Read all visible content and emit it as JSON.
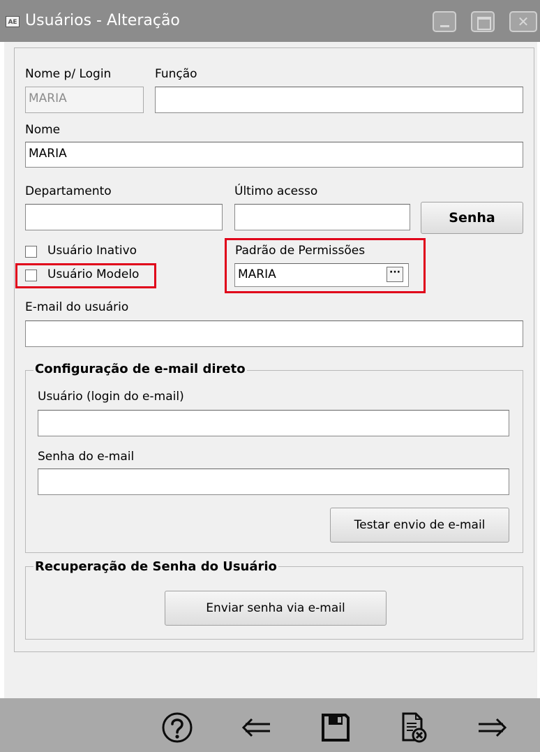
{
  "window": {
    "title": "Usuários - Alteração",
    "app_icon_text": "AE"
  },
  "form": {
    "login_label": "Nome p/ Login",
    "login_value": "MARIA",
    "funcao_label": "Função",
    "funcao_value": "",
    "nome_label": "Nome",
    "nome_value": "MARIA",
    "departamento_label": "Departamento",
    "departamento_value": "",
    "ultimo_acesso_label": "Último acesso",
    "ultimo_acesso_value": "",
    "senha_button": "Senha",
    "inativo_label": "Usuário Inativo",
    "modelo_label": "Usuário Modelo",
    "padrao_label": "Padrão de Permissões",
    "padrao_value": "MARIA",
    "padrao_button": "···",
    "email_label": "E-mail do usuário",
    "email_value": ""
  },
  "email_config": {
    "title": "Configuração de e-mail direto",
    "usuario_label": "Usuário (login do e-mail)",
    "usuario_value": "",
    "senha_label": "Senha do e-mail",
    "senha_value": "",
    "test_button": "Testar envio de e-mail"
  },
  "recovery": {
    "title": "Recuperação de Senha do Usuário",
    "send_button": "Enviar senha via e-mail"
  },
  "toolbar": {
    "icons": [
      "help-icon",
      "back-arrow-icon",
      "save-icon",
      "cancel-document-icon",
      "forward-arrow-icon"
    ]
  },
  "colors": {
    "highlight": "#e0001a",
    "titlebar": "#8c8c8c",
    "toolbar": "#a9a9a9"
  }
}
